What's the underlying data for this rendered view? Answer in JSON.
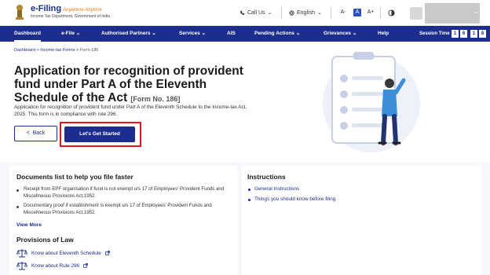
{
  "header": {
    "logo_title": "e-Filing",
    "logo_tagline": "Anywhere Anytime",
    "logo_subtitle": "Income Tax Department, Government of India",
    "call_us": "Call Us",
    "language": "English",
    "font_decrease": "A-",
    "font_normal": "A",
    "font_increase": "A+",
    "contrast_icon": "contrast-icon"
  },
  "nav": {
    "items": [
      "Dashboard",
      "e-File",
      "Authorised Partners",
      "Services",
      "AIS",
      "Pending Actions",
      "Grievances",
      "Help"
    ],
    "session_label": "Session Time",
    "session_digits": [
      "1",
      "6",
      "1",
      "8"
    ]
  },
  "breadcrumb": [
    "Dashboard",
    "Income-tax Forms",
    "Form 186"
  ],
  "hero": {
    "title": "Application for recognition of provident fund under Part A of the Eleventh Schedule of the Act",
    "form_no": "[Form No. 186]",
    "description": "Application for recognition of provident fund under Part A of the Eleventh Schedule to the Income-tax Act, 2025. This form is in compliance with rule 296.",
    "back_label": "Back",
    "start_label": "Let's Get Started"
  },
  "documents": {
    "title": "Documents list to help you file faster",
    "items": [
      "Receipt from EPF organisation if fund is not exempt u/s 17 of Employees' Provident Funds and Miscellneous Provisions Act,1952.",
      "Documentary proof if establishment is exempt u/s 17 of Employees' Provident Funds and Miscellneous Provisions Act,1952."
    ],
    "view_more": "View More"
  },
  "provisions": {
    "title": "Provisions of Law",
    "links": [
      "Know about Eleventh Schedule",
      "Know about Rule 296"
    ]
  },
  "instructions": {
    "title": "Instructions",
    "links": [
      "General Instructions",
      "Things you should know before filing"
    ]
  },
  "colors": {
    "brand": "#1d2d8c",
    "highlight": "#e0141b"
  }
}
